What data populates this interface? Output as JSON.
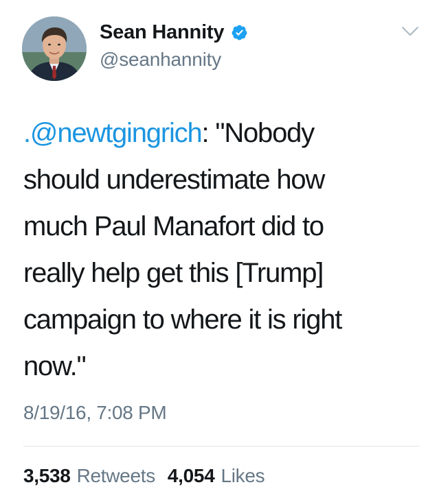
{
  "author": {
    "display_name": "Sean Hannity",
    "handle": "@seanhannity",
    "verified": true,
    "verified_badge_icon": "verified-badge-icon",
    "avatar_icon": "profile-photo"
  },
  "menu_icon": "chevron-down-icon",
  "tweet": {
    "mention": ".@newtgingrich",
    "text_line_1_rest": ": \"Nobody",
    "text_line_2": "should underestimate how",
    "text_line_3": "much Paul Manafort did to",
    "text_line_4": "really help get this [Trump]",
    "text_line_5": "campaign to where it is right",
    "text_line_6": "now.\""
  },
  "timestamp": "8/19/16, 7:08 PM",
  "stats": {
    "retweets_count": "3,538",
    "retweets_label": "Retweets",
    "likes_count": "4,054",
    "likes_label": "Likes"
  },
  "colors": {
    "link": "#1b95e0",
    "verified": "#1da1f2",
    "secondary_text": "#657786",
    "primary_text": "#14171a",
    "divider": "#e1e8ed"
  }
}
